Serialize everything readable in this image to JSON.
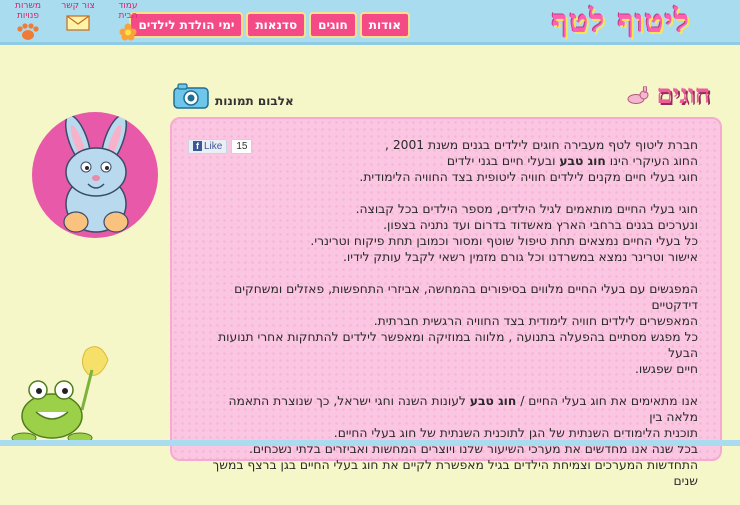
{
  "logo": {
    "text": "ליטוף לטף"
  },
  "nav": [
    {
      "label": "אודות"
    },
    {
      "label": "חוגים"
    },
    {
      "label": "סדנאות"
    },
    {
      "label": "ימי הולדת לילדים"
    }
  ],
  "utility": [
    {
      "label": "עמוד הבית",
      "icon": "flower-icon"
    },
    {
      "label": "צור קשר",
      "icon": "envelope-icon"
    },
    {
      "label": "משרות פנויות",
      "icon": "paw-icon"
    }
  ],
  "page": {
    "title": "חוגים",
    "album_label": "אלבום תמונות"
  },
  "facebook": {
    "like_label": "Like",
    "count": "15"
  },
  "content": {
    "p1": [
      "חברת ליטוף לטף מעבירה חוגים לילדים בגנים משנת 2001 ,",
      {
        "pre": "החוג העיקרי הינו ",
        "bold": "חוג טבע",
        "post": " ובעלי חיים בגני ילדים"
      },
      "חוגי בעלי חיים מקנים לילדים חוויה ליטופית בצד החוויה הלימודית."
    ],
    "p2": [
      "חוגי בעלי החיים מותאמים לגיל הילדים, מספר הילדים בכל קבוצה.",
      "ונערכים בגנים ברחבי הארץ מאשדוד בדרום ועד נתניה בצפון.",
      "כל בעלי החיים נמצאים תחת טיפול שוטף ומסור וכמובן תחת פיקוח וטרינרי.",
      "אישור וטרינר נמצא במשרדנו וכל גורם מזמין רשאי לקבל עותק לידיו."
    ],
    "p3": [
      "המפגשים עם בעלי החיים מלווים בסיפורים בהמחשה, אביזרי התחפשות, פאזלים ומשחקים דידקטיים",
      "המאפשרים לילדים חוויה לימודית בצד החוויה הרגשית חברתית.",
      "כל מפגש מסתיים בהפעלה בתנועה , מלווה במוזיקה ומאפשר לילדים להתחקות אחרי תנועות הבעל",
      "חיים שפגשו."
    ],
    "p4": [
      {
        "pre": "אנו מתאימים את חוג בעלי החיים / ",
        "bold": "חוג טבע",
        "post": " לעונות השנה וחגי ישראל, כך שנוצרת התאמה מלאה בין"
      },
      "תוכנית הלימודים השנתית של הגן לתוכנית השנתית של חוג בעלי החיים.",
      "בכל שנה אנו מחדשים את מערכי השיעור שלנו ויוצרים המחשות ואביזרים בלתי נשכחים.",
      "התחדשות המערכים וצמיחת הילדים בגיל מאפשרת לקיים את חוג בעלי החיים בגן ברצף במשך שנים"
    ]
  }
}
